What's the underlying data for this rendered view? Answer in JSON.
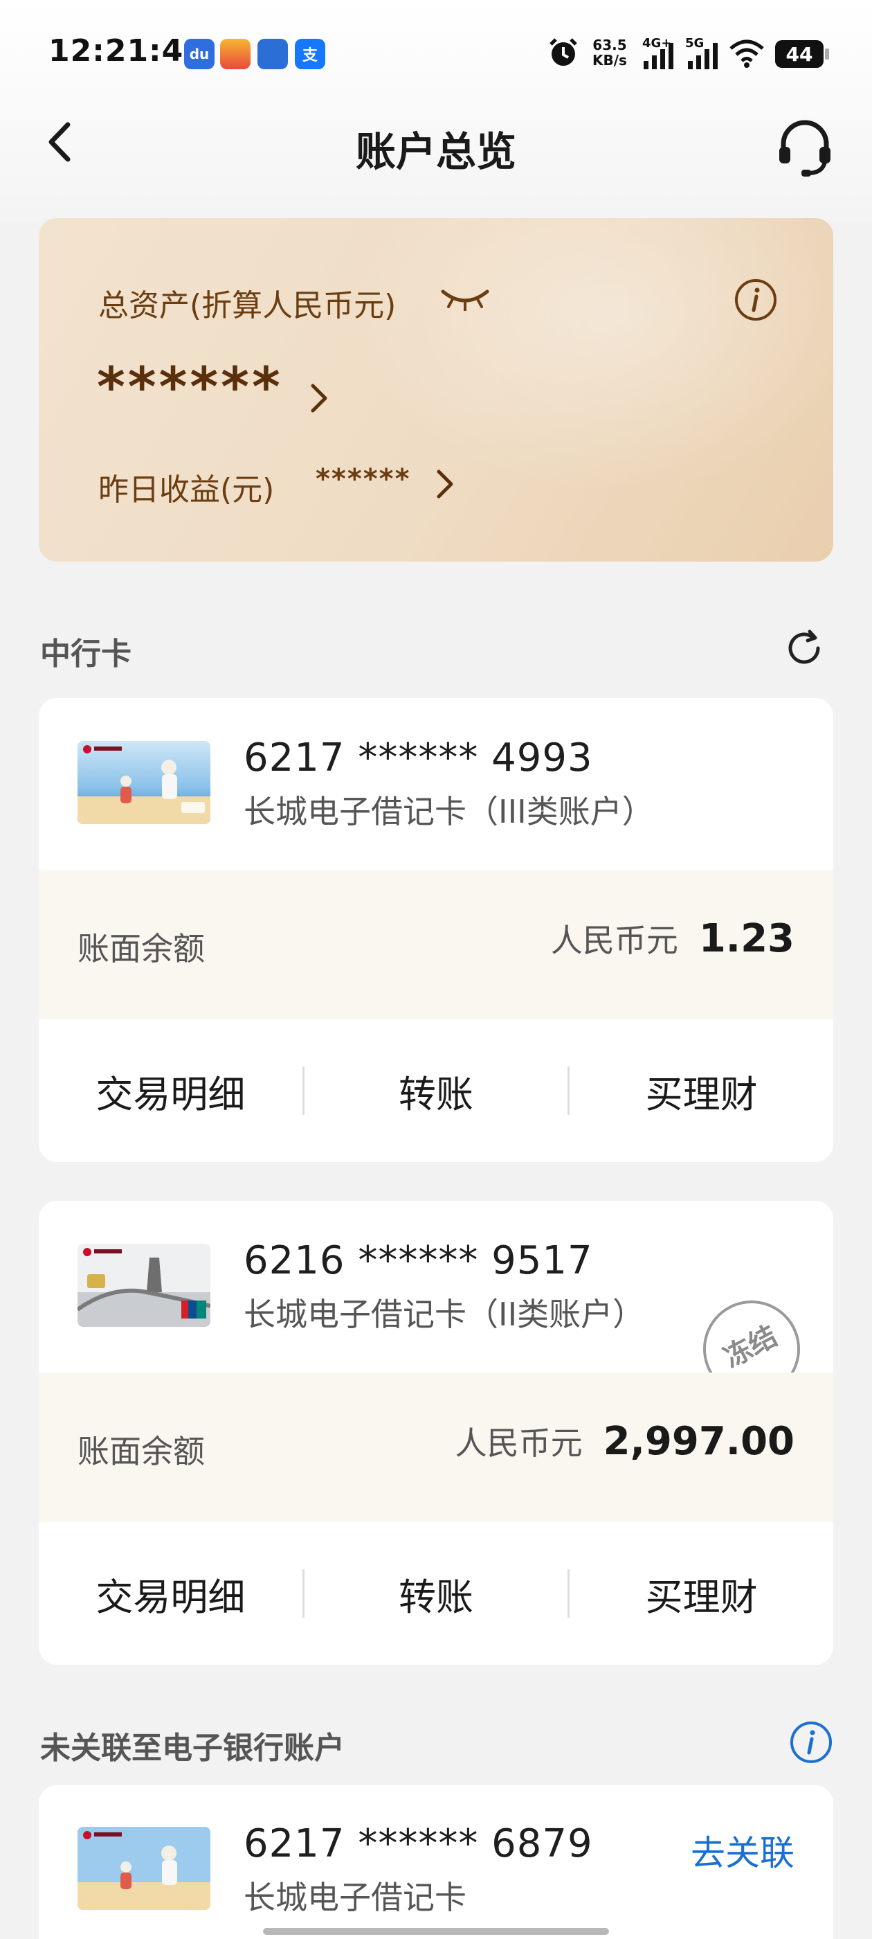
{
  "status_bar": {
    "time": "12:21:41",
    "net_speed": "63.5",
    "net_unit": "KB/s",
    "net_4g": "4G+",
    "net_5g": "5G",
    "battery": "44",
    "apps": [
      {
        "name": "baidu-app-icon",
        "glyph": "du",
        "color": "#2f6de1"
      },
      {
        "name": "pinduoduo-app-icon",
        "glyph": "",
        "color": "#e8493b"
      },
      {
        "name": "shopping-app-icon",
        "glyph": "",
        "color": "#2b6fd6"
      },
      {
        "name": "alipay-app-icon",
        "glyph": "支",
        "color": "#1677ff"
      }
    ]
  },
  "nav": {
    "title": "账户总览"
  },
  "asset": {
    "label": "总资产(折算人民币元)",
    "value": "******",
    "yesterday_label": "昨日收益(元)",
    "yesterday_value": "******"
  },
  "sections": {
    "boc_cards": "中行卡",
    "unlinked": "未关联至电子银行账户"
  },
  "cards": [
    {
      "number": "6217 ****** 4993",
      "type": "长城电子借记卡（III类账户）",
      "balance_label": "账面余额",
      "currency": "人民币元",
      "amount": "1.23",
      "actions": [
        "交易明细",
        "转账",
        "买理财"
      ]
    },
    {
      "number": "6216 ****** 9517",
      "type": "长城电子借记卡（II类账户）",
      "status": "冻结",
      "balance_label": "账面余额",
      "currency": "人民币元",
      "amount": "2,997.00",
      "actions": [
        "交易明细",
        "转账",
        "买理财"
      ]
    }
  ],
  "unlinked_card": {
    "number": "6217 ****** 6879",
    "type": "长城电子借记卡",
    "link_label": "去关联"
  },
  "colors": {
    "accent_brown": "#6b3d12",
    "link_blue": "#1a6fd1"
  }
}
